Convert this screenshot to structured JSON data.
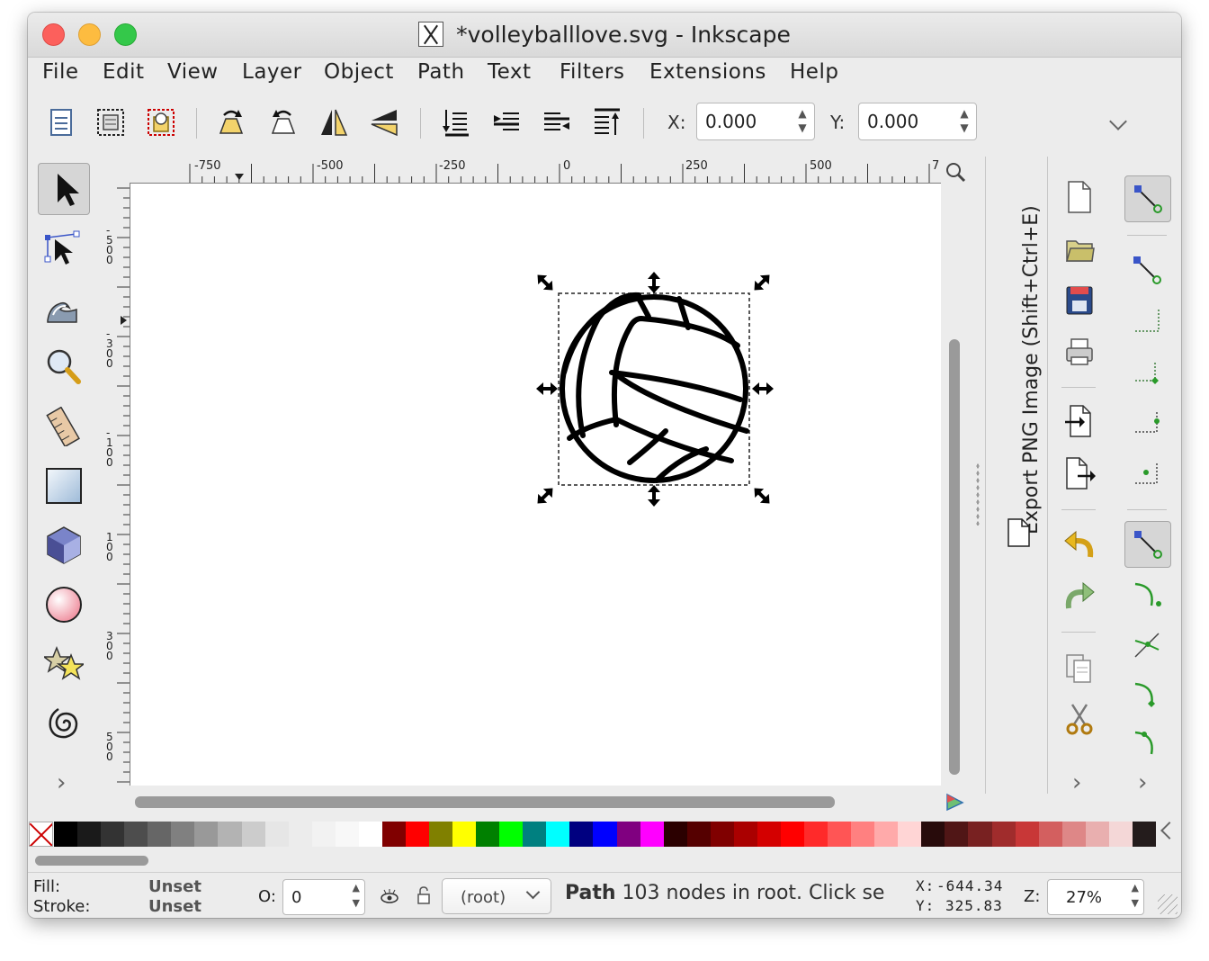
{
  "window": {
    "title": "*volleyballlove.svg - Inkscape"
  },
  "menu": [
    "File",
    "Edit",
    "View",
    "Layer",
    "Object",
    "Path",
    "Text",
    "Filters",
    "Extensions",
    "Help"
  ],
  "toolbar": {
    "x_label": "X:",
    "x_value": "0.000",
    "y_label": "Y:",
    "y_value": "0.000"
  },
  "rulers": {
    "horizontal_ticks": [
      "-750",
      "-500",
      "-250",
      "0",
      "250",
      "500",
      "7"
    ],
    "vertical_ticks": [
      "-500",
      "-300",
      "-100",
      "100",
      "300",
      "500"
    ]
  },
  "dock": {
    "tab_label": "Export PNG Image (Shift+Ctrl+E)"
  },
  "palette": {
    "colors": [
      "#000000",
      "#1a1a1a",
      "#333333",
      "#4d4d4d",
      "#666666",
      "#808080",
      "#999999",
      "#b3b3b3",
      "#cccccc",
      "#e6e6e6",
      "#ececec",
      "#f2f2f2",
      "#f8f8f8",
      "#ffffff",
      "#800000",
      "#ff0000",
      "#808000",
      "#ffff00",
      "#008000",
      "#00ff00",
      "#008080",
      "#00ffff",
      "#000080",
      "#0000ff",
      "#800080",
      "#ff00ff",
      "#2b0000",
      "#550000",
      "#800000",
      "#aa0000",
      "#d40000",
      "#ff0000",
      "#ff2a2a",
      "#ff5555",
      "#ff8080",
      "#ffaaaa",
      "#ffd5d5",
      "#280b0b",
      "#501616",
      "#782121",
      "#a02c2c",
      "#c83737",
      "#d35f5f",
      "#de8787",
      "#e9afaf",
      "#f4d7d7",
      "#241c1c"
    ]
  },
  "status": {
    "fill_label": "Fill:",
    "fill_value": "Unset",
    "stroke_label": "Stroke:",
    "stroke_value": "Unset",
    "opacity_label": "O:",
    "opacity_value": "0",
    "layer_value": "(root)",
    "message_bold": "Path",
    "message": " 103 nodes in root. Click se",
    "cursor_x_label": "X:",
    "cursor_x": "-644.34",
    "cursor_y_label": "Y:",
    "cursor_y": "325.83",
    "zoom_label": "Z:",
    "zoom_value": "27%"
  }
}
